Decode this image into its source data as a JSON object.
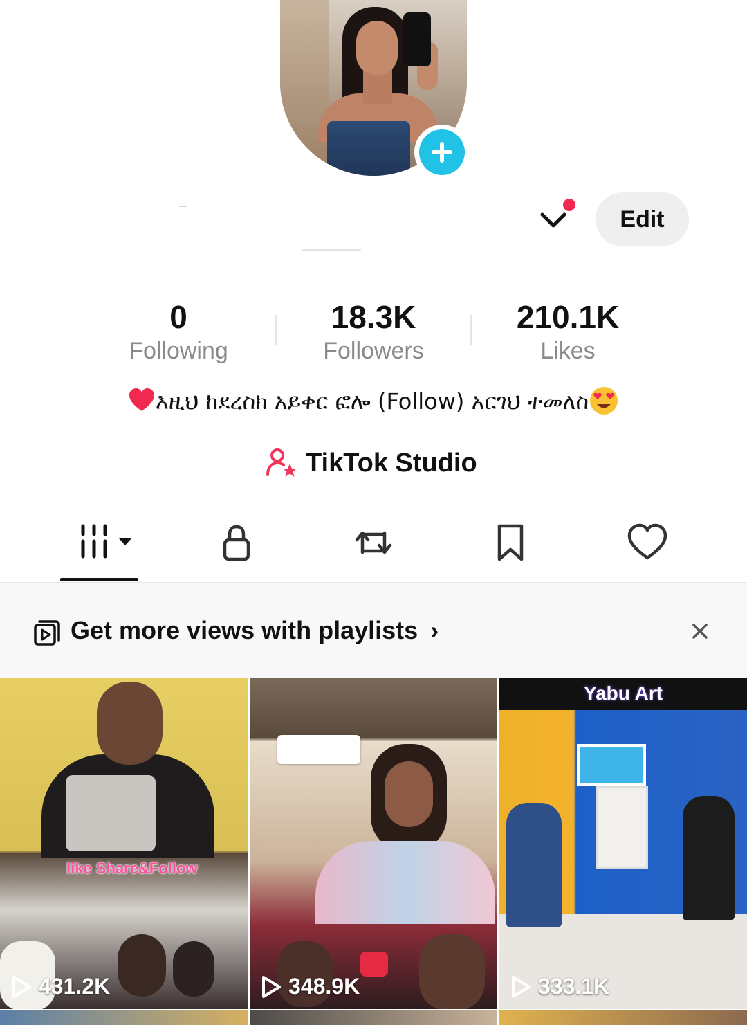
{
  "profile": {
    "edit_label": "Edit",
    "stats": [
      {
        "value": "0",
        "label": "Following"
      },
      {
        "value": "18.3K",
        "label": "Followers"
      },
      {
        "value": "210.1K",
        "label": "Likes"
      }
    ],
    "bio": "እዚህ ከደረስክ አይቀር ፎሎ (Follow) አርገህ ተመለስ",
    "studio_label": "TikTok Studio"
  },
  "tabs": [
    {
      "name": "videos",
      "icon": "grid-icon",
      "active": true
    },
    {
      "name": "private",
      "icon": "lock-icon",
      "active": false
    },
    {
      "name": "reposts",
      "icon": "repost-icon",
      "active": false
    },
    {
      "name": "favorites",
      "icon": "bookmark-icon",
      "active": false
    },
    {
      "name": "liked",
      "icon": "heart-icon",
      "active": false
    }
  ],
  "banner": {
    "text": "Get more views with playlists",
    "chevron": "›"
  },
  "videos": [
    {
      "views": "431.2K",
      "overlay_text": "like Share&Follow"
    },
    {
      "views": "348.9K"
    },
    {
      "views": "333.1K",
      "overlay_text": "Yabu Art"
    }
  ],
  "colors": {
    "accent_cyan": "#20c3e6",
    "notification_red": "#ef2950",
    "studio_pink": "#f0365a"
  }
}
